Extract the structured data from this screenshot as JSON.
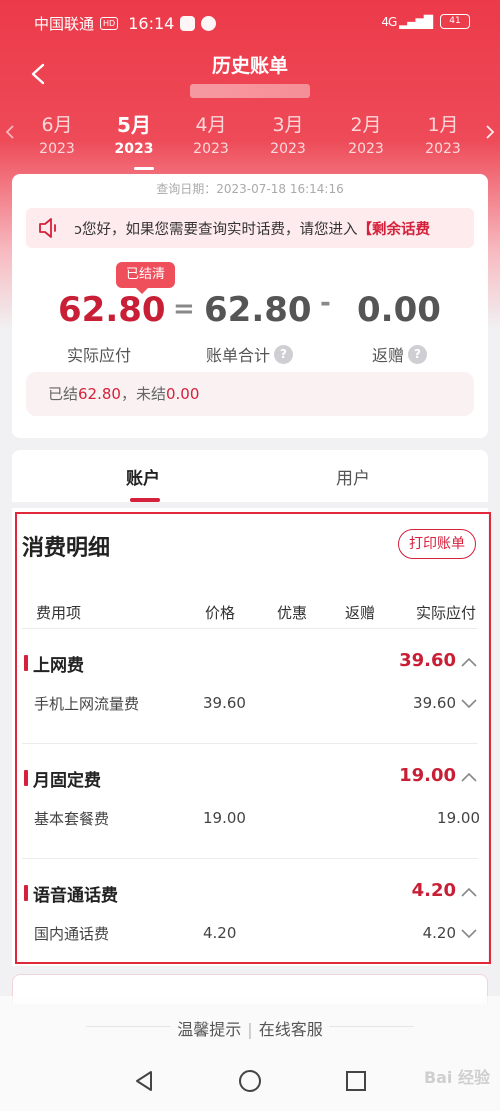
{
  "status_bar": {
    "carrier": "中国联通",
    "network_badge": "HD",
    "time": "16:14",
    "signal": "4G",
    "battery": "41"
  },
  "header": {
    "title": "历史账单"
  },
  "months": [
    {
      "month": "6月",
      "year": "2023"
    },
    {
      "month": "5月",
      "year": "2023"
    },
    {
      "month": "4月",
      "year": "2023"
    },
    {
      "month": "3月",
      "year": "2023"
    },
    {
      "month": "2月",
      "year": "2023"
    },
    {
      "month": "1月",
      "year": "2023"
    }
  ],
  "selected_month_index": 1,
  "summary": {
    "query_date": "查询日期：2023-07-18 16:14:16",
    "notice": {
      "text": "ɔ您好，如果您需要查询实时话费，请您进入",
      "link": "【剩余话费"
    },
    "status_badge": "已结清",
    "actual_due": "62.80",
    "actual_due_label": "实际应付",
    "equals": "=",
    "bill_total": "62.80",
    "bill_total_label": "账单合计",
    "minus": "-",
    "rebate": "0.00",
    "rebate_label": "返赠",
    "help_mark": "?",
    "settled_prefix": "已结",
    "settled_amount": "62.80",
    "unsettled_prefix": "，未结",
    "unsettled_amount": "0.00"
  },
  "tabs": [
    {
      "label": "账户"
    },
    {
      "label": "用户"
    }
  ],
  "detail": {
    "title": "消费明细",
    "print_button": "打印账单",
    "columns": [
      "费用项",
      "价格",
      "优惠",
      "返赠",
      "实际应付"
    ],
    "sections": [
      {
        "name": "上网费",
        "amount": "39.60",
        "items": [
          {
            "name": "手机上网流量费",
            "price": "39.60",
            "due": "39.60"
          }
        ]
      },
      {
        "name": "月固定费",
        "amount": "19.00",
        "items": [
          {
            "name": "基本套餐费",
            "price": "19.00",
            "due": "19.00"
          }
        ]
      },
      {
        "name": "语音通话费",
        "amount": "4.20",
        "items": [
          {
            "name": "国内通话费",
            "price": "4.20",
            "due": "4.20"
          }
        ]
      }
    ]
  },
  "footer": {
    "tips": "温馨提示",
    "service": "在线客服",
    "divider": "|"
  },
  "watermark": "Bai 经验",
  "colors": {
    "brand_red": "#ec3a4a",
    "amount_red": "#c81f36",
    "highlight_outline": "#e0283a"
  }
}
